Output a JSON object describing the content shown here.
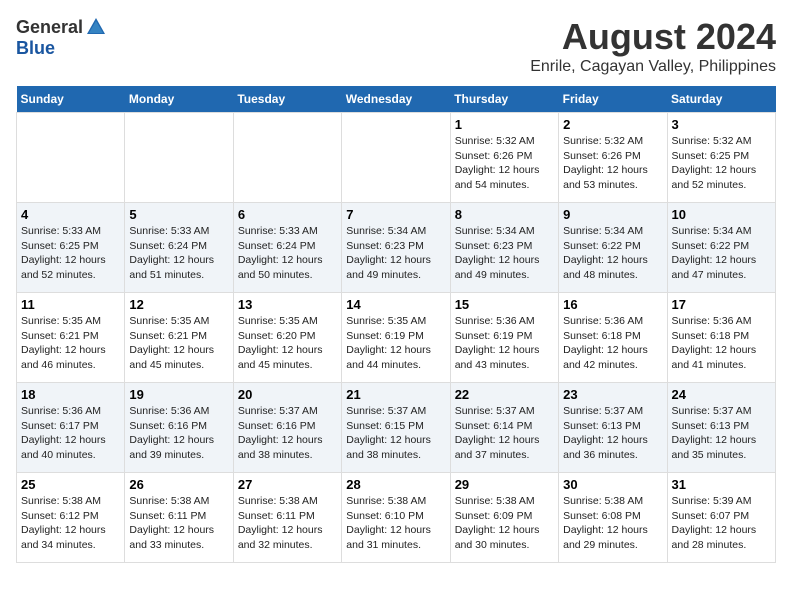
{
  "header": {
    "logo_general": "General",
    "logo_blue": "Blue",
    "title": "August 2024",
    "subtitle": "Enrile, Cagayan Valley, Philippines"
  },
  "calendar": {
    "days_of_week": [
      "Sunday",
      "Monday",
      "Tuesday",
      "Wednesday",
      "Thursday",
      "Friday",
      "Saturday"
    ],
    "weeks": [
      {
        "row_class": "week-row-1",
        "cells": [
          {
            "day": "",
            "content": ""
          },
          {
            "day": "",
            "content": ""
          },
          {
            "day": "",
            "content": ""
          },
          {
            "day": "",
            "content": ""
          },
          {
            "day": "1",
            "content": "Sunrise: 5:32 AM\nSunset: 6:26 PM\nDaylight: 12 hours\nand 54 minutes."
          },
          {
            "day": "2",
            "content": "Sunrise: 5:32 AM\nSunset: 6:26 PM\nDaylight: 12 hours\nand 53 minutes."
          },
          {
            "day": "3",
            "content": "Sunrise: 5:32 AM\nSunset: 6:25 PM\nDaylight: 12 hours\nand 52 minutes."
          }
        ]
      },
      {
        "row_class": "week-row-2",
        "cells": [
          {
            "day": "4",
            "content": "Sunrise: 5:33 AM\nSunset: 6:25 PM\nDaylight: 12 hours\nand 52 minutes."
          },
          {
            "day": "5",
            "content": "Sunrise: 5:33 AM\nSunset: 6:24 PM\nDaylight: 12 hours\nand 51 minutes."
          },
          {
            "day": "6",
            "content": "Sunrise: 5:33 AM\nSunset: 6:24 PM\nDaylight: 12 hours\nand 50 minutes."
          },
          {
            "day": "7",
            "content": "Sunrise: 5:34 AM\nSunset: 6:23 PM\nDaylight: 12 hours\nand 49 minutes."
          },
          {
            "day": "8",
            "content": "Sunrise: 5:34 AM\nSunset: 6:23 PM\nDaylight: 12 hours\nand 49 minutes."
          },
          {
            "day": "9",
            "content": "Sunrise: 5:34 AM\nSunset: 6:22 PM\nDaylight: 12 hours\nand 48 minutes."
          },
          {
            "day": "10",
            "content": "Sunrise: 5:34 AM\nSunset: 6:22 PM\nDaylight: 12 hours\nand 47 minutes."
          }
        ]
      },
      {
        "row_class": "week-row-3",
        "cells": [
          {
            "day": "11",
            "content": "Sunrise: 5:35 AM\nSunset: 6:21 PM\nDaylight: 12 hours\nand 46 minutes."
          },
          {
            "day": "12",
            "content": "Sunrise: 5:35 AM\nSunset: 6:21 PM\nDaylight: 12 hours\nand 45 minutes."
          },
          {
            "day": "13",
            "content": "Sunrise: 5:35 AM\nSunset: 6:20 PM\nDaylight: 12 hours\nand 45 minutes."
          },
          {
            "day": "14",
            "content": "Sunrise: 5:35 AM\nSunset: 6:19 PM\nDaylight: 12 hours\nand 44 minutes."
          },
          {
            "day": "15",
            "content": "Sunrise: 5:36 AM\nSunset: 6:19 PM\nDaylight: 12 hours\nand 43 minutes."
          },
          {
            "day": "16",
            "content": "Sunrise: 5:36 AM\nSunset: 6:18 PM\nDaylight: 12 hours\nand 42 minutes."
          },
          {
            "day": "17",
            "content": "Sunrise: 5:36 AM\nSunset: 6:18 PM\nDaylight: 12 hours\nand 41 minutes."
          }
        ]
      },
      {
        "row_class": "week-row-4",
        "cells": [
          {
            "day": "18",
            "content": "Sunrise: 5:36 AM\nSunset: 6:17 PM\nDaylight: 12 hours\nand 40 minutes."
          },
          {
            "day": "19",
            "content": "Sunrise: 5:36 AM\nSunset: 6:16 PM\nDaylight: 12 hours\nand 39 minutes."
          },
          {
            "day": "20",
            "content": "Sunrise: 5:37 AM\nSunset: 6:16 PM\nDaylight: 12 hours\nand 38 minutes."
          },
          {
            "day": "21",
            "content": "Sunrise: 5:37 AM\nSunset: 6:15 PM\nDaylight: 12 hours\nand 38 minutes."
          },
          {
            "day": "22",
            "content": "Sunrise: 5:37 AM\nSunset: 6:14 PM\nDaylight: 12 hours\nand 37 minutes."
          },
          {
            "day": "23",
            "content": "Sunrise: 5:37 AM\nSunset: 6:13 PM\nDaylight: 12 hours\nand 36 minutes."
          },
          {
            "day": "24",
            "content": "Sunrise: 5:37 AM\nSunset: 6:13 PM\nDaylight: 12 hours\nand 35 minutes."
          }
        ]
      },
      {
        "row_class": "week-row-5",
        "cells": [
          {
            "day": "25",
            "content": "Sunrise: 5:38 AM\nSunset: 6:12 PM\nDaylight: 12 hours\nand 34 minutes."
          },
          {
            "day": "26",
            "content": "Sunrise: 5:38 AM\nSunset: 6:11 PM\nDaylight: 12 hours\nand 33 minutes."
          },
          {
            "day": "27",
            "content": "Sunrise: 5:38 AM\nSunset: 6:11 PM\nDaylight: 12 hours\nand 32 minutes."
          },
          {
            "day": "28",
            "content": "Sunrise: 5:38 AM\nSunset: 6:10 PM\nDaylight: 12 hours\nand 31 minutes."
          },
          {
            "day": "29",
            "content": "Sunrise: 5:38 AM\nSunset: 6:09 PM\nDaylight: 12 hours\nand 30 minutes."
          },
          {
            "day": "30",
            "content": "Sunrise: 5:38 AM\nSunset: 6:08 PM\nDaylight: 12 hours\nand 29 minutes."
          },
          {
            "day": "31",
            "content": "Sunrise: 5:39 AM\nSunset: 6:07 PM\nDaylight: 12 hours\nand 28 minutes."
          }
        ]
      }
    ]
  }
}
